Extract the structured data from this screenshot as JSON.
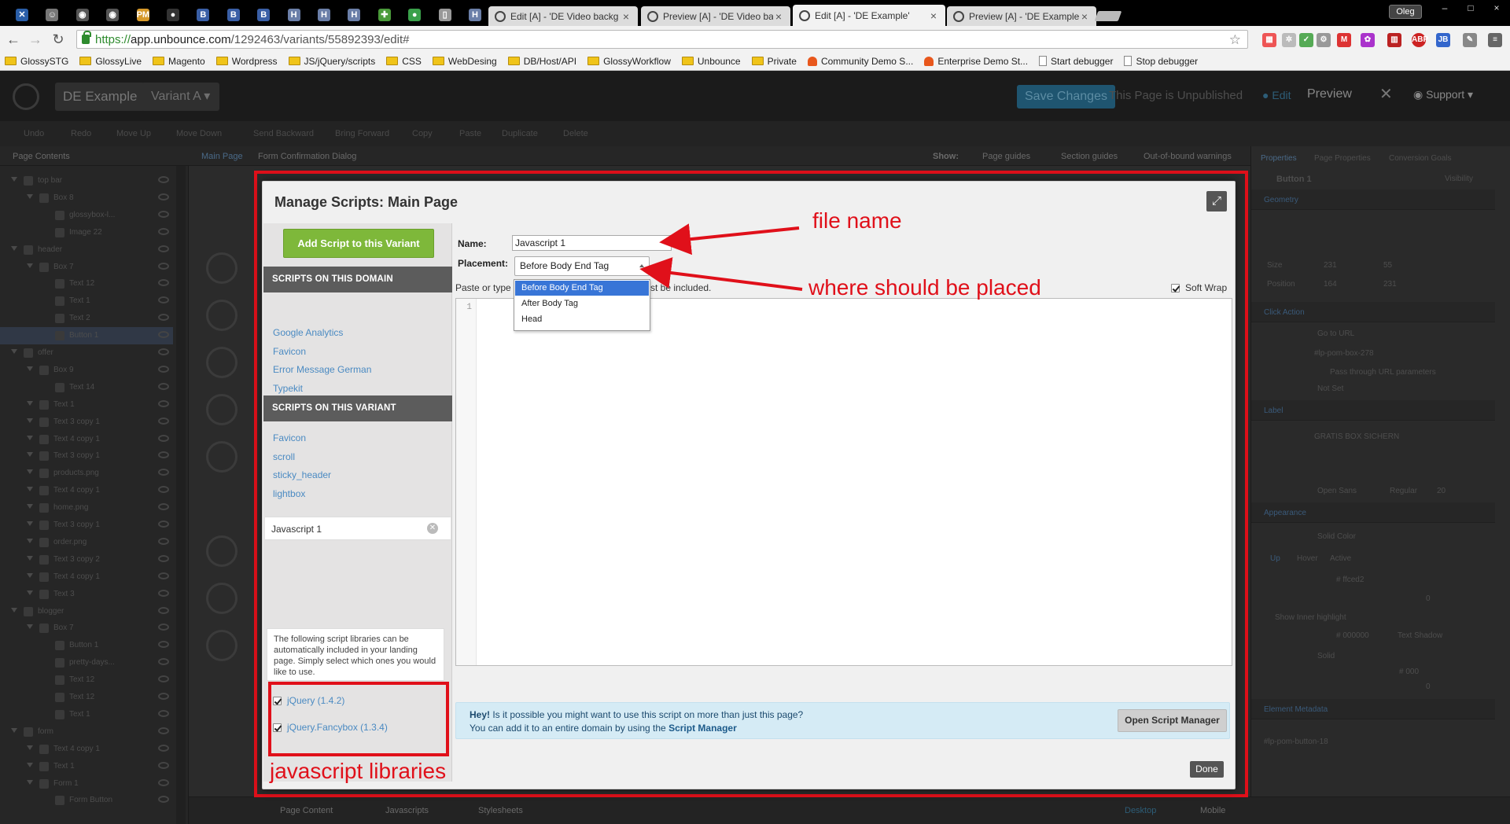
{
  "browser": {
    "pinned_tabs": [
      {
        "icon": "jira-icon",
        "color": "#2a5ea8"
      },
      {
        "icon": "avatar-icon",
        "color": "#777777"
      },
      {
        "icon": "chrome-icon",
        "color": "#555555"
      },
      {
        "icon": "chrome-icon",
        "color": "#555555"
      },
      {
        "icon": "pma-icon",
        "color": "#d79a2a"
      },
      {
        "icon": "github-icon",
        "color": "#333333"
      },
      {
        "icon": "b-icon",
        "color": "#3a5fa6"
      },
      {
        "icon": "b-icon",
        "color": "#3a5fa6"
      },
      {
        "icon": "b-icon",
        "color": "#3a5fa6"
      },
      {
        "icon": "h-icon",
        "color": "#6b7fa8"
      },
      {
        "icon": "h-icon",
        "color": "#6b7fa8"
      },
      {
        "icon": "h-icon",
        "color": "#6b7fa8"
      },
      {
        "icon": "maps-icon",
        "color": "#4a9a3a"
      },
      {
        "icon": "evernote-icon",
        "color": "#3aa04a"
      },
      {
        "icon": "page-icon",
        "color": "#999999"
      },
      {
        "icon": "h-icon",
        "color": "#6b7fa8"
      }
    ],
    "tabs": [
      {
        "title": "Edit [A] - 'DE Video backg",
        "active": false
      },
      {
        "title": "Preview [A] - 'DE Video ba",
        "active": false
      },
      {
        "title": "Edit [A] - 'DE Example'",
        "active": true
      },
      {
        "title": "Preview [A] - 'DE Example",
        "active": false
      }
    ],
    "profile_name": "Oleg",
    "url_scheme": "https://",
    "url_host": "app.unbounce.com",
    "url_path": "/1292463/variants/55892393/edit#",
    "bookmarks": [
      {
        "label": "GlossySTG",
        "kind": "folder"
      },
      {
        "label": "GlossyLive",
        "kind": "folder"
      },
      {
        "label": "Magento",
        "kind": "folder"
      },
      {
        "label": "Wordpress",
        "kind": "folder"
      },
      {
        "label": "JS/jQuery/scripts",
        "kind": "folder"
      },
      {
        "label": "CSS",
        "kind": "folder"
      },
      {
        "label": "WebDesing",
        "kind": "folder"
      },
      {
        "label": "DB/Host/API",
        "kind": "folder"
      },
      {
        "label": "GlossyWorkflow",
        "kind": "folder"
      },
      {
        "label": "Unbounce",
        "kind": "folder"
      },
      {
        "label": "Private",
        "kind": "folder"
      },
      {
        "label": "Community Demo S...",
        "kind": "magento"
      },
      {
        "label": "Enterprise Demo St...",
        "kind": "magento"
      },
      {
        "label": "Start debugger",
        "kind": "page"
      },
      {
        "label": "Stop debugger",
        "kind": "page"
      }
    ]
  },
  "app": {
    "page_name": "DE Example",
    "variant": "Variant A",
    "save_label": "Save Changes",
    "unpublished": "This Page is Unpublished",
    "edit_label": "Edit",
    "preview_label": "Preview",
    "support_label": "Support",
    "actions": [
      "Undo",
      "Redo",
      "Move Up",
      "Move Down",
      "Send Backward",
      "Bring Forward",
      "Copy",
      "Paste",
      "Duplicate",
      "Delete"
    ],
    "left_tabs": [
      "Page Contents"
    ],
    "canvas_tabs": [
      "Main Page",
      "Form Confirmation Dialog"
    ],
    "show_label": "Show:",
    "show_options": [
      "Page guides",
      "Section guides",
      "Out-of-bound warnings"
    ],
    "right_tabs": [
      "Properties",
      "Page Properties",
      "Conversion Goals"
    ],
    "tree": [
      {
        "label": "top bar",
        "level": 0
      },
      {
        "label": "Box 8",
        "level": 1
      },
      {
        "label": "glossybox-l...",
        "level": 2
      },
      {
        "label": "Image 22",
        "level": 2
      },
      {
        "label": "header",
        "level": 0
      },
      {
        "label": "Box 7",
        "level": 1
      },
      {
        "label": "Text 12",
        "level": 2
      },
      {
        "label": "Text 1",
        "level": 2
      },
      {
        "label": "Text 2",
        "level": 2
      },
      {
        "label": "Button 1",
        "level": 2
      },
      {
        "label": "offer",
        "level": 0
      },
      {
        "label": "Box 9",
        "level": 1
      },
      {
        "label": "Text 14",
        "level": 2
      },
      {
        "label": "Text 1",
        "level": 1
      },
      {
        "label": "Text 3 copy 1",
        "level": 1
      },
      {
        "label": "Text 4 copy 1",
        "level": 1
      },
      {
        "label": "Text 3 copy 1",
        "level": 1
      },
      {
        "label": "products.png",
        "level": 1
      },
      {
        "label": "Text 4 copy 1",
        "level": 1
      },
      {
        "label": "home.png",
        "level": 1
      },
      {
        "label": "Text 3 copy 1",
        "level": 1
      },
      {
        "label": "order.png",
        "level": 1
      },
      {
        "label": "Text 3 copy 2",
        "level": 1
      },
      {
        "label": "Text 4 copy 1",
        "level": 1
      },
      {
        "label": "Text 3",
        "level": 1
      },
      {
        "label": "blogger",
        "level": 0
      },
      {
        "label": "Box 7",
        "level": 1
      },
      {
        "label": "Button 1",
        "level": 2
      },
      {
        "label": "pretty-days...",
        "level": 2
      },
      {
        "label": "Text 12",
        "level": 2
      },
      {
        "label": "Text 12",
        "level": 2
      },
      {
        "label": "Text 1",
        "level": 2
      },
      {
        "label": "form",
        "level": 0
      },
      {
        "label": "Text 4 copy 1",
        "level": 1
      },
      {
        "label": "Text 1",
        "level": 1
      },
      {
        "label": "Form 1",
        "level": 1
      },
      {
        "label": "Form Button",
        "level": 2
      }
    ],
    "properties": {
      "element": "Button 1",
      "visibility": "Visibility",
      "geometry": "Geometry",
      "size_w": "231",
      "size_h": "55",
      "pos_l": "164",
      "pos_t": "231",
      "click_action": "Click Action",
      "action_value": "Go to URL",
      "url_value": "#lp-pom-box-278",
      "pass_params": "Pass through URL parameters",
      "target_value": "Not Set",
      "label_section": "Label",
      "label_text": "GRATIS BOX SICHERN",
      "label_font": "Open Sans",
      "label_weight": "Regular",
      "label_size": "20",
      "appearance": "Appearance",
      "style_value": "Solid Color",
      "state_tabs": [
        "Up",
        "Hover",
        "Active"
      ],
      "color_value": "# ffced2",
      "opacity_value": "0",
      "inner_highlight": "Show Inner highlight",
      "text_color": "# 000000",
      "text_shadow": "Text Shadow",
      "border_style": "Solid",
      "border_color": "# 000",
      "corner_radius": "0",
      "element_metadata": "Element Metadata",
      "id_value": "#lp-pom-button-18"
    },
    "bottom_tabs": [
      "Page Content",
      "Javascripts",
      "Stylesheets"
    ],
    "device_tabs": [
      "Desktop",
      "Mobile"
    ]
  },
  "modal": {
    "title": "Manage Scripts: Main Page",
    "add_button": "Add Script to this Variant",
    "domain_header": "SCRIPTS ON THIS DOMAIN",
    "domain_scripts": [
      "Google Analytics",
      "Favicon",
      "Error Message German",
      "Typekit"
    ],
    "variant_header": "SCRIPTS ON THIS VARIANT",
    "variant_scripts": [
      "Favicon",
      "scroll",
      "sticky_header",
      "lightbox"
    ],
    "current_script": "Javascript 1",
    "libraries_info": "The following script libraries can be automatically included in your landing page. Simply select which ones you would like to use.",
    "libraries": [
      {
        "label": "jQuery (1.4.2)",
        "checked": true
      },
      {
        "label": "jQuery.Fancybox (1.3.4)",
        "checked": true
      }
    ],
    "name_label": "Name:",
    "name_value": "Javascript 1",
    "placement_label": "Placement:",
    "placement_value": "Before Body End Tag",
    "placement_options": [
      "Before Body End Tag",
      "After Body Tag",
      "Head"
    ],
    "paste_text_start": "Paste or type",
    "paste_text_end": "st be included.",
    "soft_wrap": "Soft Wrap",
    "line_number": "1",
    "hint_bold": "Hey!",
    "hint_line1": " Is it possible you might want to use this script on more than just this page?",
    "hint_line2": "You can add it to an entire domain by using the ",
    "hint_link": "Script Manager",
    "open_script_manager": "Open Script Manager",
    "done": "Done"
  },
  "annotations": {
    "file_name": "file name",
    "placement": "where should be placed",
    "libraries": "javascript libraries",
    "color": "#e0101a"
  }
}
